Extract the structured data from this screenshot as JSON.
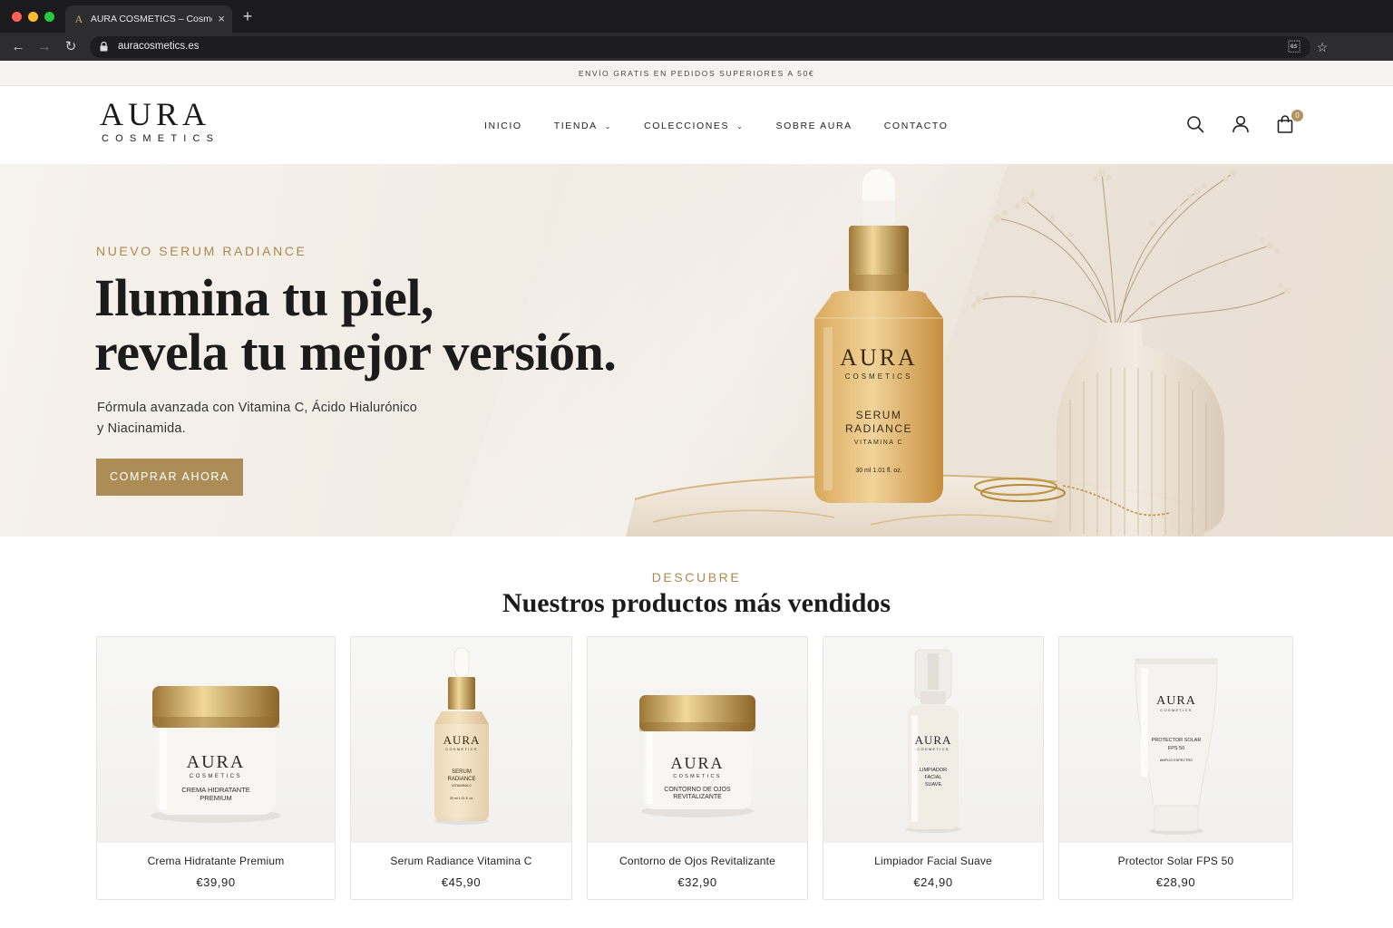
{
  "browser": {
    "tab_title": "AURA COSMETICS – Cosmética",
    "tab_favicon": "A",
    "close_glyph": "×",
    "new_tab_glyph": "+",
    "url": "auracosmetics.es"
  },
  "site": {
    "promo_text": "ENVÍO GRATIS EN PEDIDOS SUPERIORES A 50€",
    "logo_main": "AURA",
    "logo_sub": "COSMETICS",
    "nav": [
      {
        "label": "INICIO",
        "dropdown": false
      },
      {
        "label": "TIENDA",
        "dropdown": true
      },
      {
        "label": "COLECCIONES",
        "dropdown": true
      },
      {
        "label": "SOBRE AURA",
        "dropdown": false
      },
      {
        "label": "CONTACTO",
        "dropdown": false
      }
    ],
    "icons": {
      "search": "search-icon",
      "account": "user-icon",
      "cart": "shopping-bag-icon"
    },
    "cart_count": "0"
  },
  "hero": {
    "kicker": "NUEVO SERUM RADIANCE",
    "title_line1": "Ilumina tu piel,",
    "title_line2": "revela tu mejor versión.",
    "desc_line1": "Fórmula avanzada con Vitamina C, Ácido Hialurónico",
    "desc_line2": "y Niacinamida.",
    "cta": "COMPRAR AHORA",
    "bottle": {
      "brand": "AURA",
      "brand_sub": "COSMETICS",
      "product_line1": "SERUM",
      "product_line2": "RADIANCE",
      "product_line3": "VITAMINA C",
      "volume": "30 ml  1.01 fl. oz."
    }
  },
  "products_section": {
    "kicker": "DESCUBRE",
    "title": "Nuestros productos más vendidos",
    "items": [
      {
        "name": "Crema Hidratante Premium",
        "price": "€39,90",
        "label_brand": "AURA",
        "label_sub": "COSMETICS",
        "label_l1": "CREMA HIDRATANTE",
        "label_l2": "PREMIUM"
      },
      {
        "name": "Serum Radiance Vitamina C",
        "price": "€45,90",
        "label_brand": "AURA",
        "label_sub": "COSMETICS",
        "label_l1": "SERUM",
        "label_l2": "RADIANCE",
        "label_l3": "VITAMINA C",
        "label_vol": "30 ml  1.01 fl. oz."
      },
      {
        "name": "Contorno de Ojos Revitalizante",
        "price": "€32,90",
        "label_brand": "AURA",
        "label_sub": "COSMETICS",
        "label_l1": "CONTORNO DE OJOS",
        "label_l2": "REVITALIZANTE"
      },
      {
        "name": "Limpiador Facial Suave",
        "price": "€24,90",
        "label_brand": "AURA",
        "label_sub": "COSMETICS",
        "label_l1": "LIMPIADOR",
        "label_l2": "FACIAL",
        "label_l3": "SUAVE"
      },
      {
        "name": "Protector Solar FPS 50",
        "price": "€28,90",
        "label_brand": "AURA",
        "label_sub": "COSMETICS",
        "label_l1": "PROTECTOR SOLAR",
        "label_l2": "FPS 50",
        "label_l3": "AMPLIO ESPECTRO"
      }
    ]
  },
  "colors": {
    "accent_gold": "#ac8d56",
    "text": "#1b1b1b",
    "chrome_dark": "#1b1b1d"
  }
}
